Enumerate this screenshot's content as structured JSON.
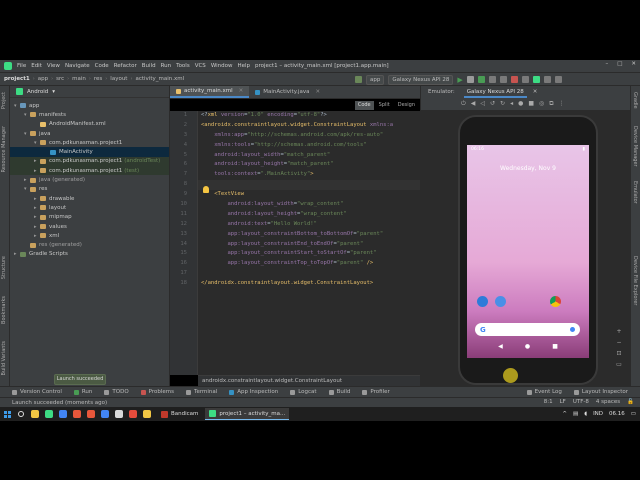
{
  "window": {
    "title": "project1 – activity_main.xml [project1.app.main]",
    "menu": [
      "File",
      "Edit",
      "View",
      "Navigate",
      "Code",
      "Refactor",
      "Build",
      "Run",
      "Tools",
      "VCS",
      "Window",
      "Help"
    ]
  },
  "breadcrumbs": [
    "project1",
    "app",
    "src",
    "main",
    "res",
    "layout",
    "activity_main.xml"
  ],
  "toolbar": {
    "run_config": "app",
    "device": "Galaxy Nexus API 28"
  },
  "side_tabs_left": [
    "Project",
    "Resource Manager",
    "Structure",
    "Bookmarks",
    "Build Variants"
  ],
  "side_tabs_right": [
    "Gradle",
    "Device Manager",
    "Emulator",
    "Device File Explorer"
  ],
  "project_panel": {
    "view": "Android",
    "tree": [
      {
        "label": "app",
        "suffix": "",
        "depth": 0,
        "arrow": "▾",
        "icon": "#6897bb"
      },
      {
        "label": "manifests",
        "suffix": "",
        "depth": 1,
        "arrow": "▾",
        "icon": "#c9a15d"
      },
      {
        "label": "AndroidManifest.xml",
        "suffix": "",
        "depth": 2,
        "arrow": "",
        "icon": "#e8bf6a"
      },
      {
        "label": "java",
        "suffix": "",
        "depth": 1,
        "arrow": "▾",
        "icon": "#c9a15d"
      },
      {
        "label": "com.pdkunasman.project1",
        "suffix": "",
        "depth": 2,
        "arrow": "▾",
        "icon": "#c9a15d"
      },
      {
        "label": "MainActivity",
        "suffix": "",
        "depth": 3,
        "arrow": "",
        "icon": "#3592c4",
        "selected": true
      },
      {
        "label": "com.pdkunasman.project1",
        "suffix": "(androidTest)",
        "depth": 2,
        "arrow": "▸",
        "icon": "#c9a15d",
        "highlight": true
      },
      {
        "label": "com.pdkunasman.project1",
        "suffix": "(test)",
        "depth": 2,
        "arrow": "▸",
        "icon": "#c9a15d",
        "highlight": true
      },
      {
        "label": "java (generated)",
        "suffix": "",
        "depth": 1,
        "arrow": "▸",
        "icon": "#c9a15d",
        "muted": true
      },
      {
        "label": "res",
        "suffix": "",
        "depth": 1,
        "arrow": "▾",
        "icon": "#c9a15d"
      },
      {
        "label": "drawable",
        "suffix": "",
        "depth": 2,
        "arrow": "▸",
        "icon": "#c9a15d"
      },
      {
        "label": "layout",
        "suffix": "",
        "depth": 2,
        "arrow": "▸",
        "icon": "#c9a15d"
      },
      {
        "label": "mipmap",
        "suffix": "",
        "depth": 2,
        "arrow": "▸",
        "icon": "#c9a15d"
      },
      {
        "label": "values",
        "suffix": "",
        "depth": 2,
        "arrow": "▸",
        "icon": "#c9a15d"
      },
      {
        "label": "xml",
        "suffix": "",
        "depth": 2,
        "arrow": "▸",
        "icon": "#c9a15d"
      },
      {
        "label": "res (generated)",
        "suffix": "",
        "depth": 1,
        "arrow": "",
        "icon": "#c9a15d",
        "muted": true
      },
      {
        "label": "Gradle Scripts",
        "suffix": "",
        "depth": 0,
        "arrow": "▸",
        "icon": "#6a8759"
      }
    ]
  },
  "editor": {
    "tabs": [
      {
        "label": "activity_main.xml",
        "active": true,
        "icon": "#e8bf6a"
      },
      {
        "label": "MainActivity.java",
        "active": false,
        "icon": "#3592c4"
      }
    ],
    "view_modes": [
      "Code",
      "Split",
      "Design"
    ],
    "active_view_mode": "Code",
    "line_numbers": [
      "1",
      "2",
      "3",
      "4",
      "5",
      "6",
      "7",
      "8",
      "9",
      "10",
      "11",
      "12",
      "13",
      "14",
      "15",
      "16",
      "17",
      "18"
    ],
    "lines": [
      [
        [
          "t-plain",
          "<?"
        ],
        [
          "t-tag",
          "xml "
        ],
        [
          "t-attr",
          "version"
        ],
        [
          "t-plain",
          "="
        ],
        [
          "t-str",
          "\"1.0\" "
        ],
        [
          "t-attr",
          "encoding"
        ],
        [
          "t-plain",
          "="
        ],
        [
          "t-str",
          "\"utf-8\""
        ],
        [
          "t-plain",
          "?>"
        ]
      ],
      [
        [
          "t-tag",
          "<androidx.constraintlayout.widget.ConstraintLayout "
        ],
        [
          "t-ns",
          "xmlns:a"
        ]
      ],
      [
        [
          "t-plain",
          "    "
        ],
        [
          "t-ns",
          "xmlns:app"
        ],
        [
          "t-plain",
          "="
        ],
        [
          "t-str",
          "\"http://schemas.android.com/apk/res-auto\""
        ]
      ],
      [
        [
          "t-plain",
          "    "
        ],
        [
          "t-ns",
          "xmlns:tools"
        ],
        [
          "t-plain",
          "="
        ],
        [
          "t-str",
          "\"http://schemas.android.com/tools\""
        ]
      ],
      [
        [
          "t-plain",
          "    "
        ],
        [
          "t-attr",
          "android:layout_width"
        ],
        [
          "t-plain",
          "="
        ],
        [
          "t-str",
          "\"match_parent\""
        ]
      ],
      [
        [
          "t-plain",
          "    "
        ],
        [
          "t-attr",
          "android:layout_height"
        ],
        [
          "t-plain",
          "="
        ],
        [
          "t-str",
          "\"match_parent\""
        ]
      ],
      [
        [
          "t-plain",
          "    "
        ],
        [
          "t-attr",
          "tools:context"
        ],
        [
          "t-plain",
          "="
        ],
        [
          "t-str",
          "\".MainActivity\""
        ],
        [
          "t-tag",
          ">"
        ]
      ],
      [
        [
          "t-plain",
          ""
        ]
      ],
      [
        [
          "t-plain",
          "    "
        ],
        [
          "t-tag",
          "<TextView"
        ]
      ],
      [
        [
          "t-plain",
          "        "
        ],
        [
          "t-attr",
          "android:layout_width"
        ],
        [
          "t-plain",
          "="
        ],
        [
          "t-str",
          "\"wrap_content\""
        ]
      ],
      [
        [
          "t-plain",
          "        "
        ],
        [
          "t-attr",
          "android:layout_height"
        ],
        [
          "t-plain",
          "="
        ],
        [
          "t-str",
          "\"wrap_content\""
        ]
      ],
      [
        [
          "t-plain",
          "        "
        ],
        [
          "t-attr",
          "android:text"
        ],
        [
          "t-plain",
          "="
        ],
        [
          "t-str",
          "\"Hello World!\""
        ]
      ],
      [
        [
          "t-plain",
          "        "
        ],
        [
          "t-attr",
          "app:layout_constraintBottom_toBottomOf"
        ],
        [
          "t-plain",
          "="
        ],
        [
          "t-str",
          "\"parent\""
        ]
      ],
      [
        [
          "t-plain",
          "        "
        ],
        [
          "t-attr",
          "app:layout_constraintEnd_toEndOf"
        ],
        [
          "t-plain",
          "="
        ],
        [
          "t-str",
          "\"parent\""
        ]
      ],
      [
        [
          "t-plain",
          "        "
        ],
        [
          "t-attr",
          "app:layout_constraintStart_toStartOf"
        ],
        [
          "t-plain",
          "="
        ],
        [
          "t-str",
          "\"parent\""
        ]
      ],
      [
        [
          "t-plain",
          "        "
        ],
        [
          "t-attr",
          "app:layout_constraintTop_toTopOf"
        ],
        [
          "t-plain",
          "="
        ],
        [
          "t-str",
          "\"parent\" "
        ],
        [
          "t-tag",
          "/>"
        ]
      ],
      [
        [
          "t-plain",
          ""
        ]
      ],
      [
        [
          "t-tag",
          "</androidx.constraintlayout.widget.ConstraintLayout>"
        ]
      ]
    ],
    "current_line": 8,
    "breadcrumb": "androidx.constraintlayout.widget.ConstraintLayout"
  },
  "emulator": {
    "tabs": [
      "Emulator:",
      "Galaxy Nexus API 28"
    ],
    "phone": {
      "time": "06:16",
      "date": "Wednesday, Nov 9"
    }
  },
  "toast": "Launch succeeded",
  "tool_windows": [
    {
      "label": "Version Control",
      "color": "#9a9a9a"
    },
    {
      "label": "Run",
      "color": "#499c54"
    },
    {
      "label": "TODO",
      "color": "#9a9a9a"
    },
    {
      "label": "Problems",
      "color": "#c75450"
    },
    {
      "label": "Terminal",
      "color": "#9a9a9a"
    },
    {
      "label": "App Inspection",
      "color": "#3592c4"
    },
    {
      "label": "Logcat",
      "color": "#9a9a9a"
    },
    {
      "label": "Build",
      "color": "#9a9a9a"
    },
    {
      "label": "Profiler",
      "color": "#9a9a9a"
    }
  ],
  "tool_windows_right": [
    "Event Log",
    "Layout Inspector"
  ],
  "status": {
    "message": "Launch succeeded (moments ago)",
    "position": "8:1",
    "line_sep": "LF",
    "encoding": "UTF-8",
    "indent": "4 spaces"
  },
  "taskbar": {
    "apps": [
      {
        "label": "Bandicam",
        "active": false,
        "icon": "#c0392b"
      },
      {
        "label": "project1 – activity_ma...",
        "active": true,
        "icon": "#3ddc84"
      }
    ],
    "pinned_colors": [
      "#f2c744",
      "#3ddc84",
      "#4285f4",
      "#e8573b",
      "#e8573b",
      "#4285f4",
      "#d9d9d9",
      "#e74c3c",
      "#f2c744"
    ],
    "lang": "IND",
    "time": "06.16"
  }
}
